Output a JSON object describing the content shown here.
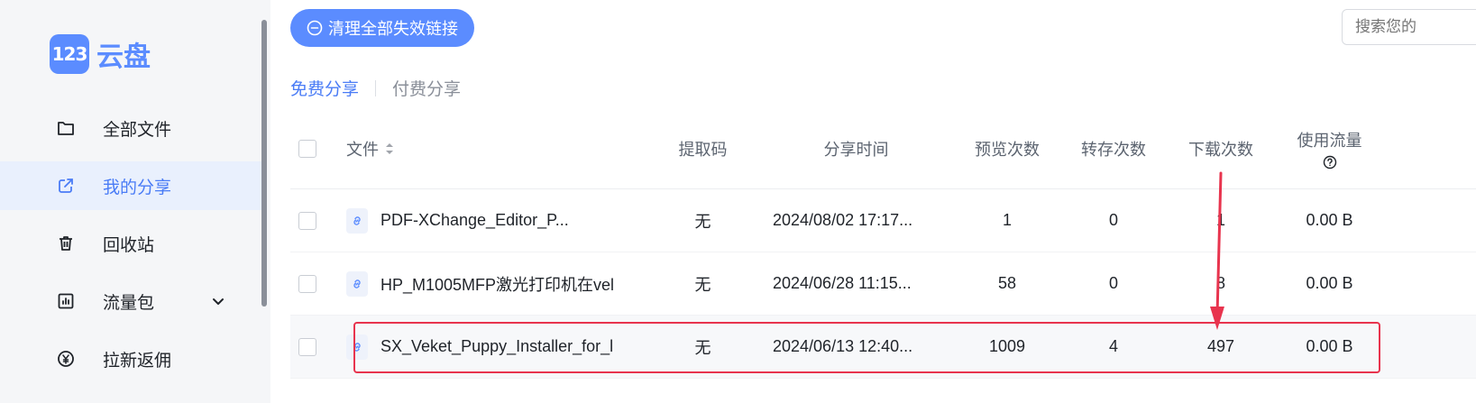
{
  "brand": {
    "logo_mark": "123",
    "logo_text": "云盘",
    "color": "#5b8cff"
  },
  "sidebar": {
    "items": [
      {
        "label": "全部文件",
        "icon": "folder-icon",
        "active": false
      },
      {
        "label": "我的分享",
        "icon": "share-icon",
        "active": true
      },
      {
        "label": "回收站",
        "icon": "trash-icon",
        "active": false
      },
      {
        "label": "流量包",
        "icon": "chart-icon",
        "active": false,
        "expandable": true
      },
      {
        "label": "拉新返佣",
        "icon": "yen-icon",
        "active": false
      }
    ]
  },
  "toolbar": {
    "clean_label": "清理全部失效链接",
    "search_placeholder": "搜索您的"
  },
  "tabs": [
    {
      "label": "免费分享",
      "active": true
    },
    {
      "label": "付费分享",
      "active": false
    }
  ],
  "table": {
    "headers": {
      "file": "文件",
      "code": "提取码",
      "time": "分享时间",
      "previews": "预览次数",
      "saves": "转存次数",
      "downloads": "下载次数",
      "flow": "使用流量"
    },
    "rows": [
      {
        "name": "PDF-XChange_Editor_P...",
        "code": "无",
        "time": "2024/08/02 17:17...",
        "previews": "1",
        "saves": "0",
        "downloads": "1",
        "flow": "0.00 B"
      },
      {
        "name": "HP_M1005MFP激光打印机在vel",
        "code": "无",
        "time": "2024/06/28 11:15...",
        "previews": "58",
        "saves": "0",
        "downloads": "8",
        "flow": "0.00 B"
      },
      {
        "name": "SX_Veket_Puppy_Installer_for_l",
        "code": "无",
        "time": "2024/06/13 12:40...",
        "previews": "1009",
        "saves": "4",
        "downloads": "497",
        "flow": "0.00 B"
      }
    ]
  },
  "colors": {
    "accent": "#4a7cf6",
    "annotation": "#e8344e",
    "active_bg": "#e9f0fd"
  }
}
